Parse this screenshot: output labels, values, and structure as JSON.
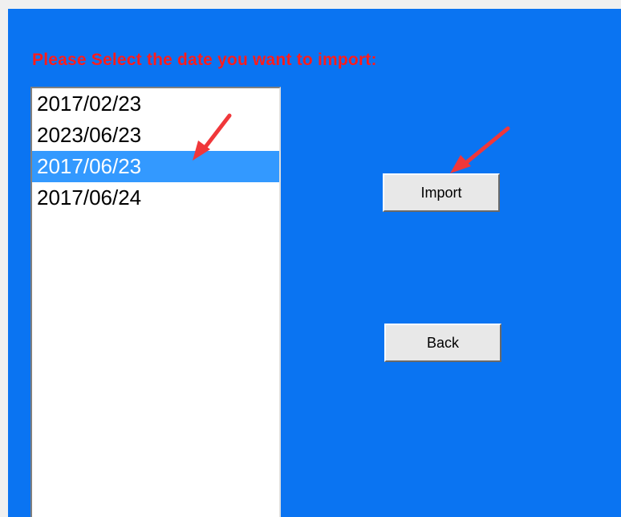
{
  "prompt_text": "Please Select the date you want to import:",
  "date_list": {
    "items": [
      "2017/02/23",
      "2023/06/23",
      "2017/06/23",
      "2017/06/24"
    ],
    "selected_index": 2
  },
  "buttons": {
    "import_label": "Import",
    "back_label": "Back"
  },
  "colors": {
    "panel_background": "#0a74f2",
    "prompt_text": "#ff1c1c",
    "selection_highlight": "#3399ff",
    "annotation_arrow": "#f0373a"
  },
  "annotations": [
    "arrow-pointing-to-selected-date",
    "arrow-pointing-to-import-button"
  ]
}
